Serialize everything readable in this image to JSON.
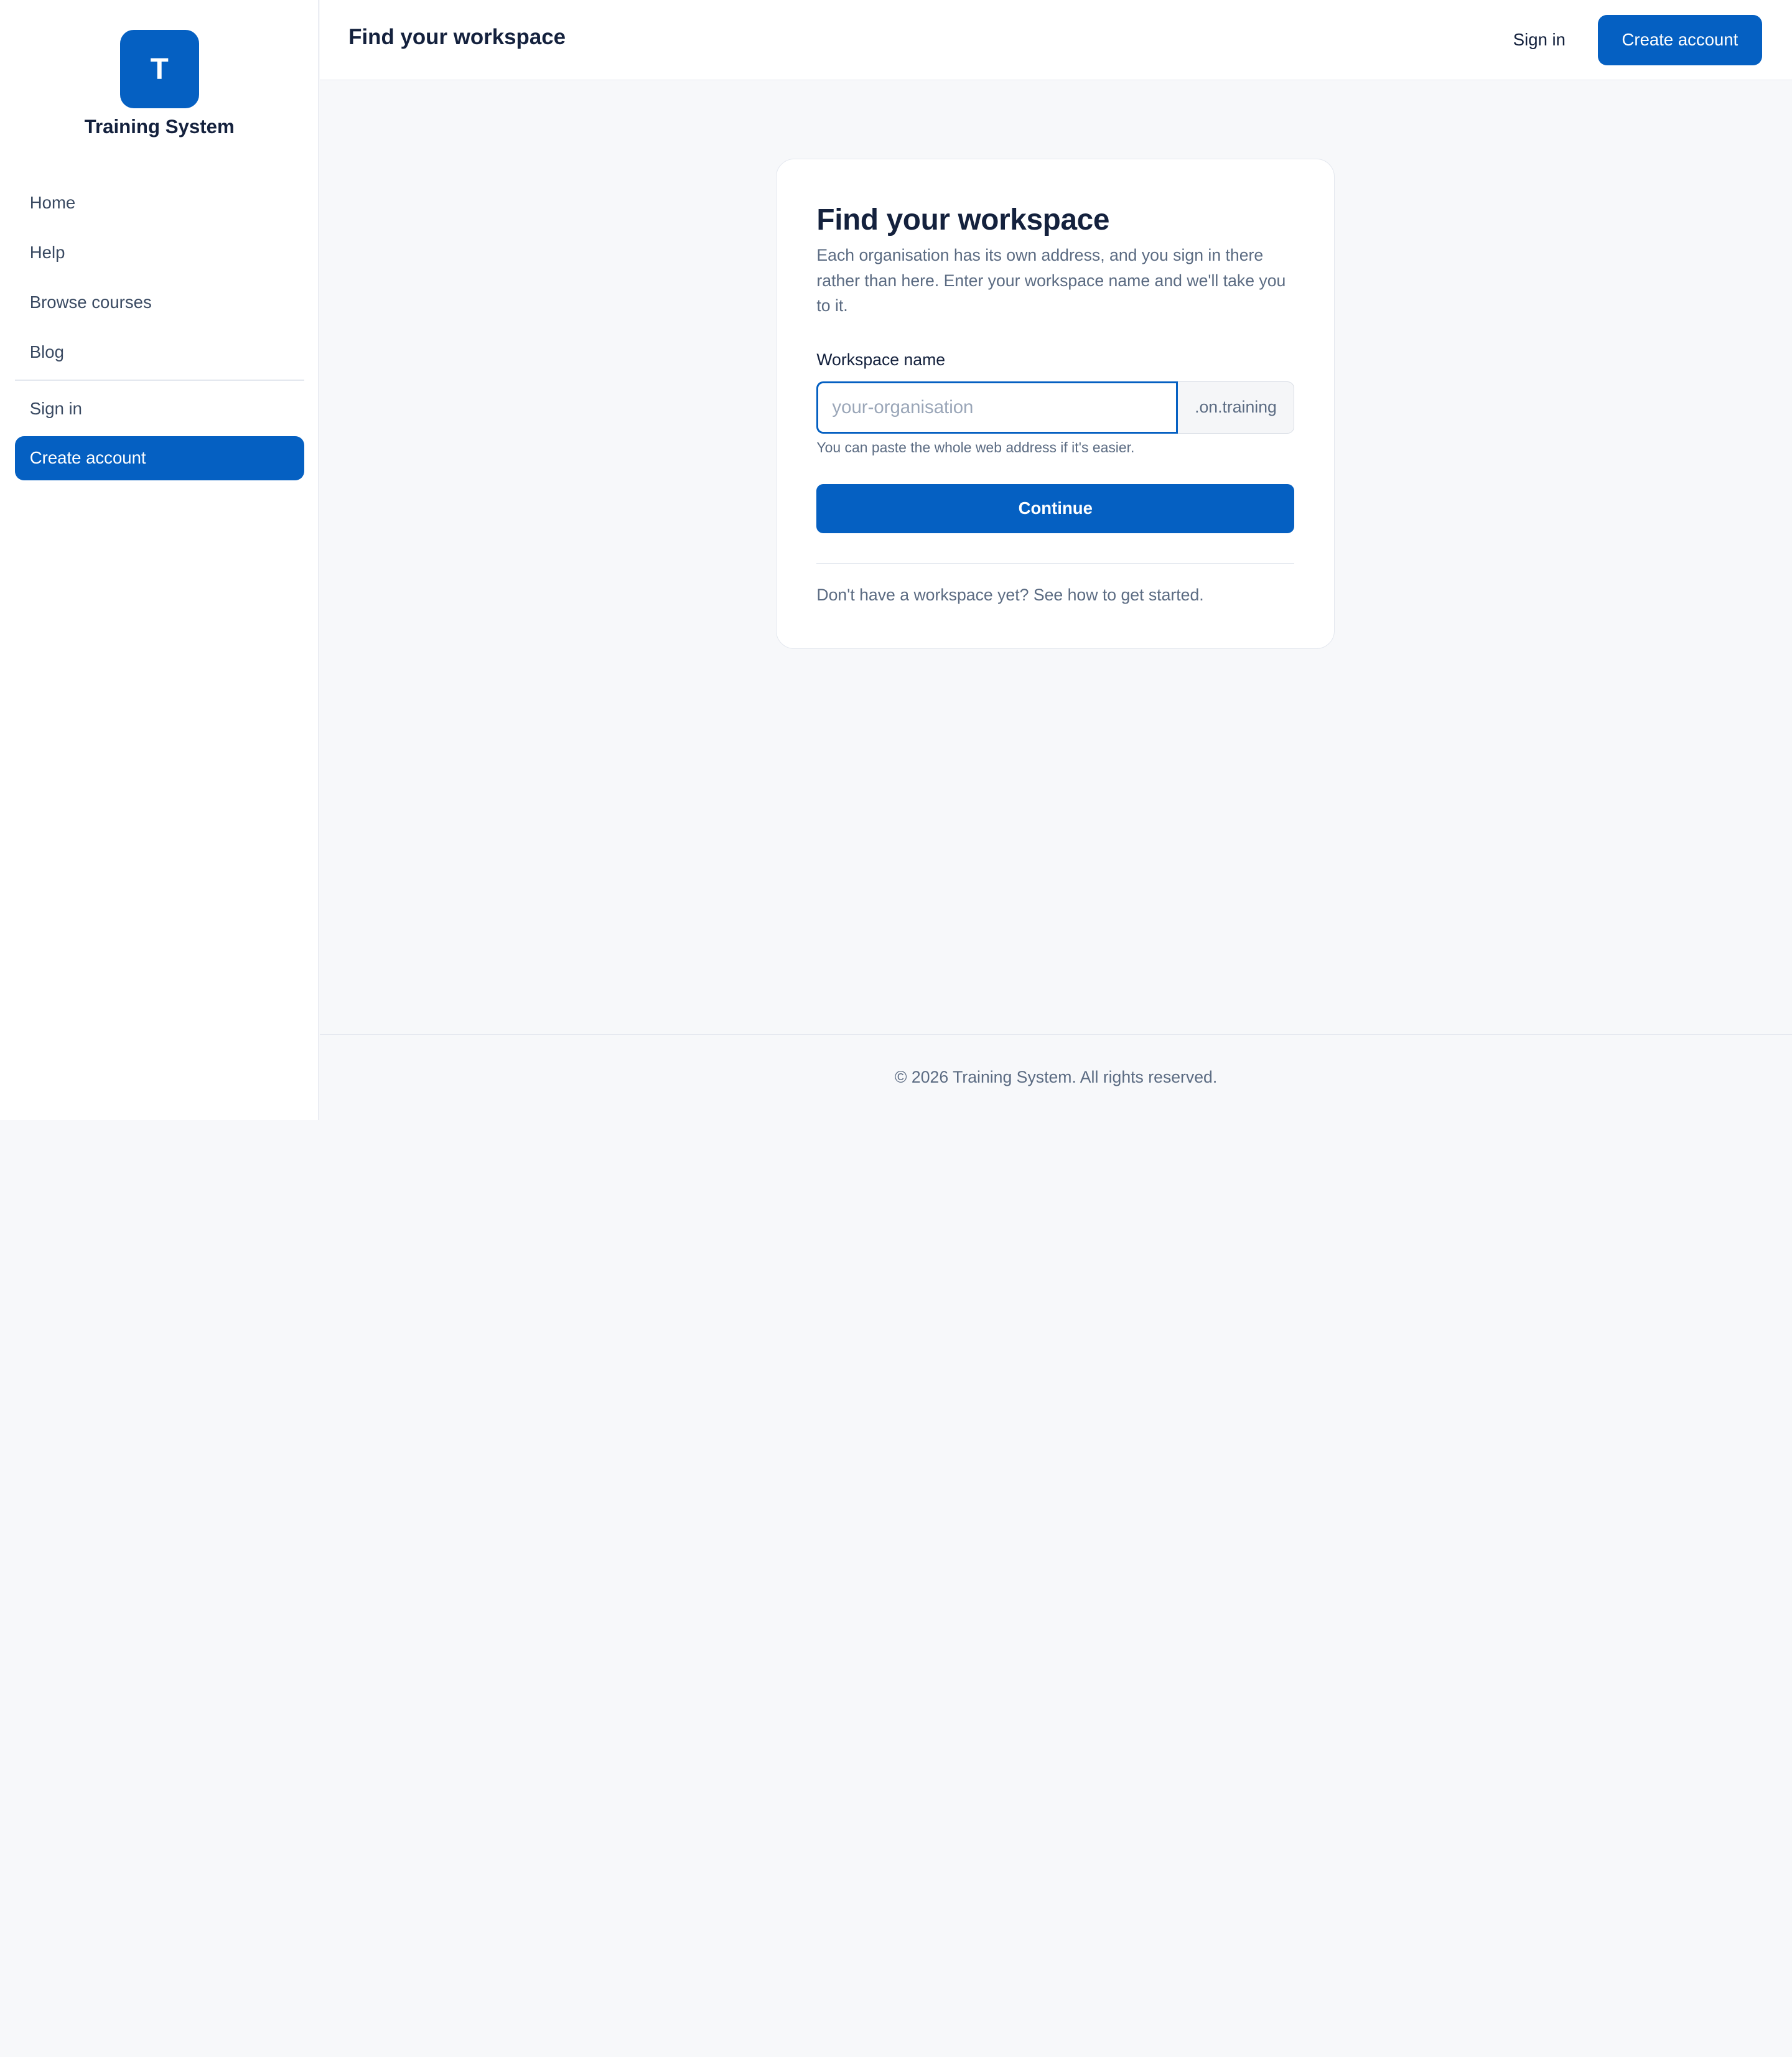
{
  "brand": {
    "initial": "T",
    "name": "Training System",
    "accent_color": "#0560C2"
  },
  "sidebar": {
    "items": [
      {
        "label": "Home"
      },
      {
        "label": "Help"
      },
      {
        "label": "Browse courses"
      },
      {
        "label": "Blog"
      },
      {
        "label": "Sign in"
      },
      {
        "label": "Create account",
        "active": true
      }
    ]
  },
  "topbar": {
    "title": "Find your workspace",
    "signin_label": "Sign in",
    "create_label": "Create account"
  },
  "card": {
    "title": "Find your workspace",
    "description": "Each organisation has its own address, and you sign in there rather than here. Enter your workspace name and we'll take you to it.",
    "field_label": "Workspace name",
    "input_value": "",
    "input_placeholder": "your-organisation",
    "suffix": ".on.training",
    "hint": "You can paste the whole web address if it's easier.",
    "continue_label": "Continue",
    "footer_prefix": "Don't have a workspace yet?",
    "footer_link": "See how to get started."
  },
  "footer": {
    "text": "© 2026 Training System. All rights reserved."
  }
}
